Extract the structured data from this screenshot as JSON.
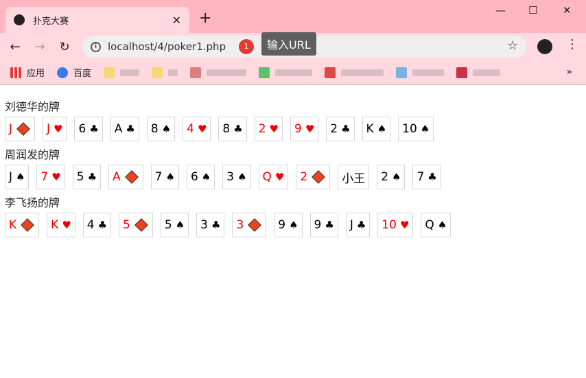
{
  "browser": {
    "tab_title": "扑克大赛",
    "url": "localhost/4/poker1.php",
    "badge_count": "1",
    "tooltip": "输入URL",
    "bookmarks": [
      {
        "label": "应用",
        "icon": "apps-grid-icon"
      },
      {
        "label": "百度",
        "icon": "baidu-paw-icon"
      }
    ]
  },
  "players": [
    {
      "label": "刘德华的牌",
      "cards": [
        {
          "rank": "J",
          "suit": "diamond"
        },
        {
          "rank": "J",
          "suit": "heart"
        },
        {
          "rank": "6",
          "suit": "club"
        },
        {
          "rank": "A",
          "suit": "club"
        },
        {
          "rank": "8",
          "suit": "spade"
        },
        {
          "rank": "4",
          "suit": "heart"
        },
        {
          "rank": "8",
          "suit": "club"
        },
        {
          "rank": "2",
          "suit": "heart"
        },
        {
          "rank": "9",
          "suit": "heart"
        },
        {
          "rank": "2",
          "suit": "club"
        },
        {
          "rank": "K",
          "suit": "spade"
        },
        {
          "rank": "10",
          "suit": "spade"
        }
      ]
    },
    {
      "label": "周润发的牌",
      "cards": [
        {
          "rank": "J",
          "suit": "spade"
        },
        {
          "rank": "7",
          "suit": "heart"
        },
        {
          "rank": "5",
          "suit": "club"
        },
        {
          "rank": "A",
          "suit": "diamond"
        },
        {
          "rank": "7",
          "suit": "spade"
        },
        {
          "rank": "6",
          "suit": "spade"
        },
        {
          "rank": "3",
          "suit": "spade"
        },
        {
          "rank": "Q",
          "suit": "heart"
        },
        {
          "rank": "2",
          "suit": "diamond"
        },
        {
          "rank": "小王",
          "suit": ""
        },
        {
          "rank": "2",
          "suit": "spade"
        },
        {
          "rank": "7",
          "suit": "club"
        }
      ]
    },
    {
      "label": "李飞扬的牌",
      "cards": [
        {
          "rank": "K",
          "suit": "diamond"
        },
        {
          "rank": "K",
          "suit": "heart"
        },
        {
          "rank": "4",
          "suit": "club"
        },
        {
          "rank": "5",
          "suit": "diamond"
        },
        {
          "rank": "5",
          "suit": "spade"
        },
        {
          "rank": "3",
          "suit": "club"
        },
        {
          "rank": "3",
          "suit": "diamond"
        },
        {
          "rank": "9",
          "suit": "spade"
        },
        {
          "rank": "9",
          "suit": "club"
        },
        {
          "rank": "J",
          "suit": "club"
        },
        {
          "rank": "10",
          "suit": "heart"
        },
        {
          "rank": "Q",
          "suit": "spade"
        }
      ]
    }
  ],
  "suit_glyphs": {
    "heart": "♥",
    "spade": "♠",
    "club": "♣",
    "diamond": ""
  },
  "colors": {
    "chrome": "#ffb6c1",
    "red_rank": "#ee0000",
    "diamond_fill": "#e8441e"
  }
}
